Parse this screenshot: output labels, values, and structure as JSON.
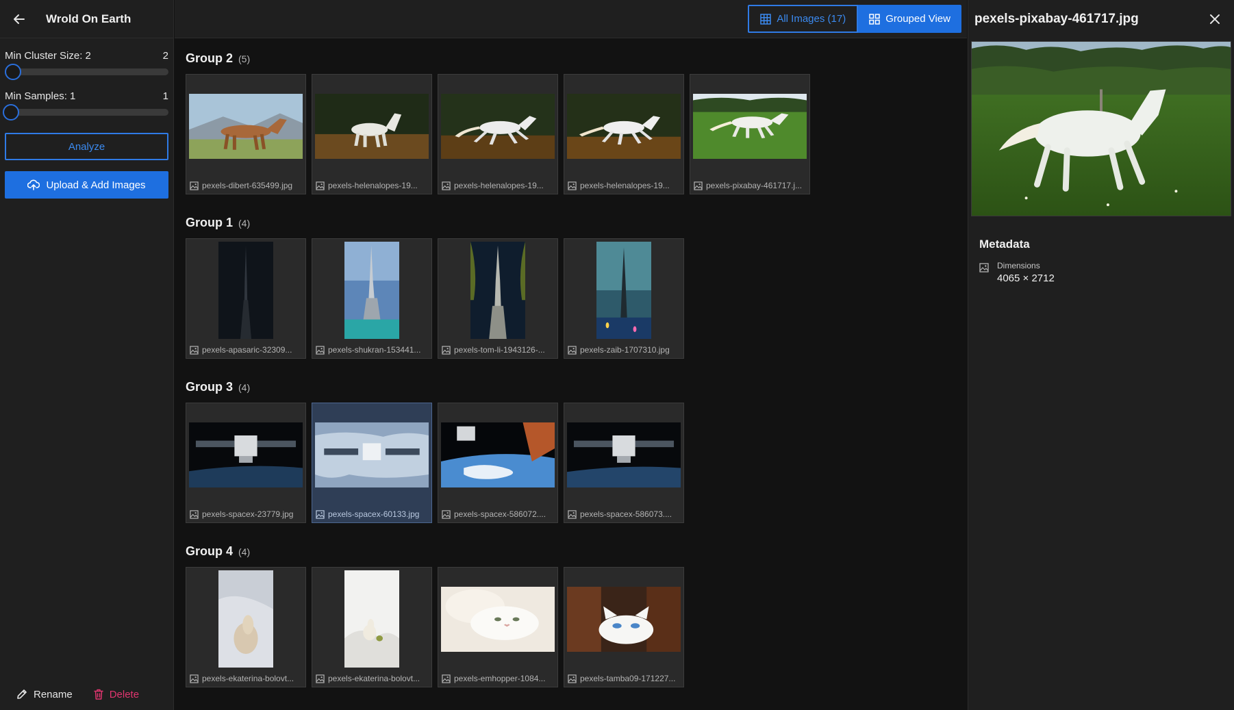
{
  "header": {
    "title": "Wrold On Earth"
  },
  "controls": {
    "min_cluster_label": "Min Cluster Size: 2",
    "min_cluster_value": "2",
    "min_samples_label": "Min Samples: 1",
    "min_samples_value": "1",
    "analyze_label": "Analyze",
    "upload_label": "Upload & Add Images"
  },
  "footer": {
    "rename_label": "Rename",
    "delete_label": "Delete"
  },
  "view_toggle": {
    "all_label": "All Images (17)",
    "grouped_label": "Grouped View"
  },
  "groups": [
    {
      "title": "Group 2",
      "count": "(5)",
      "images": [
        {
          "caption": "pexels-dibert-635499.jpg",
          "orientation": "landscape"
        },
        {
          "caption": "pexels-helenalopes-19...",
          "orientation": "landscape"
        },
        {
          "caption": "pexels-helenalopes-19...",
          "orientation": "landscape"
        },
        {
          "caption": "pexels-helenalopes-19...",
          "orientation": "landscape"
        },
        {
          "caption": "pexels-pixabay-461717.j...",
          "orientation": "landscape"
        }
      ]
    },
    {
      "title": "Group 1",
      "count": "(4)",
      "images": [
        {
          "caption": "pexels-apasaric-32309...",
          "orientation": "portrait"
        },
        {
          "caption": "pexels-shukran-153441...",
          "orientation": "portrait"
        },
        {
          "caption": "pexels-tom-li-1943126-...",
          "orientation": "portrait"
        },
        {
          "caption": "pexels-zaib-1707310.jpg",
          "orientation": "portrait"
        }
      ]
    },
    {
      "title": "Group 3",
      "count": "(4)",
      "images": [
        {
          "caption": "pexels-spacex-23779.jpg",
          "orientation": "landscape"
        },
        {
          "caption": "pexels-spacex-60133.jpg",
          "orientation": "landscape",
          "selected": true
        },
        {
          "caption": "pexels-spacex-586072....",
          "orientation": "landscape"
        },
        {
          "caption": "pexels-spacex-586073....",
          "orientation": "landscape"
        }
      ]
    },
    {
      "title": "Group 4",
      "count": "(4)",
      "images": [
        {
          "caption": "pexels-ekaterina-bolovt...",
          "orientation": "portrait"
        },
        {
          "caption": "pexels-ekaterina-bolovt...",
          "orientation": "portrait"
        },
        {
          "caption": "pexels-emhopper-1084...",
          "orientation": "landscape"
        },
        {
          "caption": "pexels-tamba09-171227...",
          "orientation": "landscape"
        }
      ]
    }
  ],
  "detail": {
    "title": "pexels-pixabay-461717.jpg",
    "metadata_heading": "Metadata",
    "dimensions_label": "Dimensions",
    "dimensions_value": "4065 × 2712"
  },
  "colors": {
    "accent": "#1e6fe0",
    "accent_outline": "#2f7be6",
    "delete": "#e0356f",
    "background": "#121212",
    "panel": "#1f1f1f",
    "card": "#2a2a2a",
    "card_selected": "#2f3e56"
  },
  "icons": {
    "back": "arrow-left-icon",
    "upload": "cloud-upload-icon",
    "rename": "pencil-icon",
    "delete": "trash-icon",
    "all_images": "grid-icon",
    "grouped": "grouped-grid-icon",
    "close": "close-icon",
    "image": "image-icon"
  }
}
